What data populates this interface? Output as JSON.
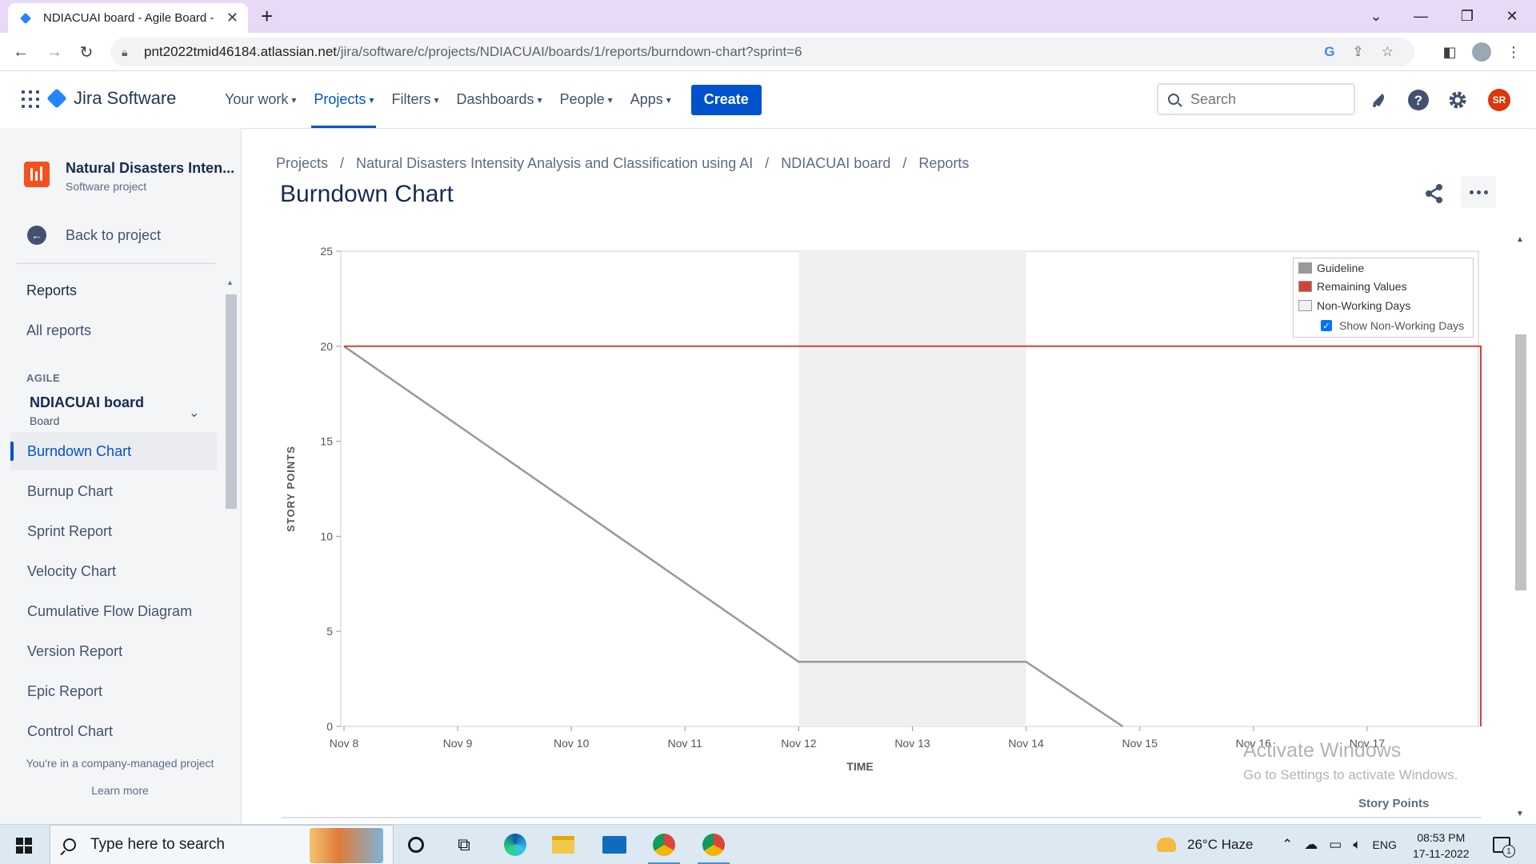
{
  "browser": {
    "tab_title": "NDIACUAI board - Agile Board -",
    "url_host": "pnt2022tmid46184.atlassian.net",
    "url_path": "/jira/software/c/projects/NDIACUAI/boards/1/reports/burndown-chart?sprint=6"
  },
  "jira_nav": {
    "product": "Jira Software",
    "items": [
      {
        "label": "Your work",
        "active": false
      },
      {
        "label": "Projects",
        "active": true
      },
      {
        "label": "Filters",
        "active": false
      },
      {
        "label": "Dashboards",
        "active": false
      },
      {
        "label": "People",
        "active": false
      },
      {
        "label": "Apps",
        "active": false
      }
    ],
    "create_label": "Create",
    "search_placeholder": "Search",
    "avatar_initials": "SR"
  },
  "sidebar": {
    "project_name": "Natural Disasters Inten...",
    "project_type": "Software project",
    "back_label": "Back to project",
    "reports_heading": "Reports",
    "all_reports": "All reports",
    "agile_label": "AGILE",
    "board_name": "NDIACUAI board",
    "board_type": "Board",
    "items": [
      {
        "label": "Burndown Chart",
        "active": true
      },
      {
        "label": "Burnup Chart",
        "active": false
      },
      {
        "label": "Sprint Report",
        "active": false
      },
      {
        "label": "Velocity Chart",
        "active": false
      },
      {
        "label": "Cumulative Flow Diagram",
        "active": false
      },
      {
        "label": "Version Report",
        "active": false
      },
      {
        "label": "Epic Report",
        "active": false
      },
      {
        "label": "Control Chart",
        "active": false
      }
    ],
    "footer_text": "You're in a company-managed project",
    "learn_more": "Learn more"
  },
  "main": {
    "breadcrumb": [
      "Projects",
      "Natural Disasters Intensity Analysis and Classification using AI",
      "NDIACUAI board",
      "Reports"
    ],
    "title": "Burndown Chart",
    "story_points_link": "Story Points"
  },
  "chart_data": {
    "type": "line",
    "ylabel": "STORY POINTS",
    "xlabel": "TIME",
    "ylim": [
      0,
      25
    ],
    "y_ticks": [
      0,
      5,
      10,
      15,
      20,
      25
    ],
    "x_ticks": [
      "Nov 8",
      "Nov 9",
      "Nov 10",
      "Nov 11",
      "Nov 12",
      "Nov 13",
      "Nov 14",
      "Nov 15",
      "Nov 16",
      "Nov 17"
    ],
    "x_range_days": [
      0,
      10
    ],
    "non_working_days": [
      [
        4,
        6
      ]
    ],
    "series": [
      {
        "name": "Guideline",
        "color": "#999999",
        "x": [
          0,
          4,
          6,
          6.85
        ],
        "y": [
          20,
          3.4,
          3.4,
          0
        ]
      },
      {
        "name": "Remaining Values",
        "color": "#d04437",
        "x": [
          0,
          10,
          10
        ],
        "y": [
          20,
          20,
          0
        ]
      }
    ],
    "legend": {
      "items": [
        {
          "label": "Guideline",
          "color": "#999999"
        },
        {
          "label": "Remaining Values",
          "color": "#d04437"
        },
        {
          "label": "Non-Working Days",
          "color": "#f0f0f0"
        }
      ],
      "checkbox_label": "Show Non-Working Days",
      "checkbox_checked": true,
      "placement": "top-right"
    }
  },
  "watermark": {
    "line1": "Activate Windows",
    "line2": "Go to Settings to activate Windows."
  },
  "taskbar": {
    "search_placeholder": "Type here to search",
    "weather": "26°C  Haze",
    "language": "ENG",
    "time": "08:53 PM",
    "date": "17-11-2022",
    "notification_count": "1"
  }
}
